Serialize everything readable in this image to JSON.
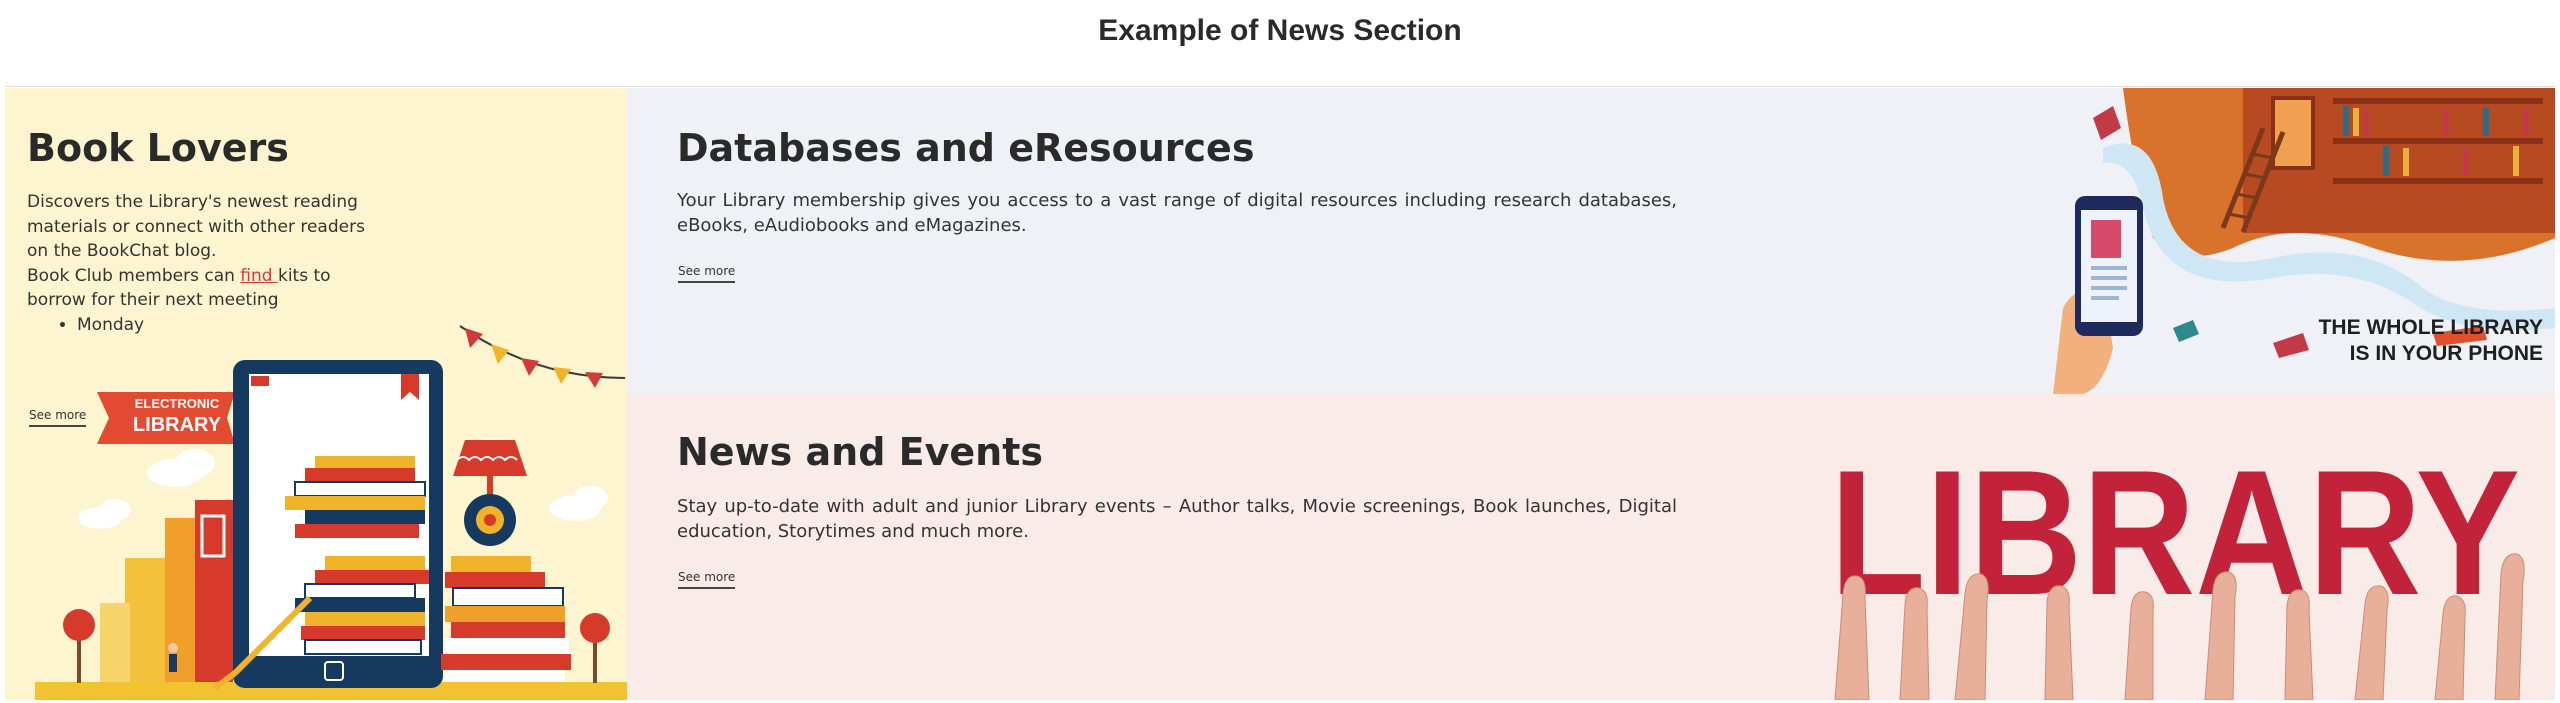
{
  "page": {
    "title": "Example of News Section"
  },
  "book_lovers": {
    "title": "Book Lovers",
    "line1": "Discovers the Library's newest reading materials or connect with other readers on the BookChat blog.",
    "line2_before": "Book Club members can ",
    "line2_link": "find ",
    "line2_after": "kits to borrow for their next meeting",
    "list": [
      "Monday"
    ],
    "see_more": "See more",
    "badge_top": "ELECTRONIC",
    "badge_bottom": "LIBRARY"
  },
  "databases": {
    "title": "Databases and eResources",
    "text": "Your Library membership gives you access to a vast range of digital resources including research databases, eBooks, eAudiobooks and eMagazines.",
    "see_more": "See more",
    "image_caption_1": "THE WHOLE LIBRARY",
    "image_caption_2": "IS IN YOUR PHONE"
  },
  "news": {
    "title": "News and Events",
    "text": "Stay up-to-date with adult and junior Library events – Author talks, Movie screenings, Book launches, Digital education, Storytimes and much more.",
    "see_more": "See more",
    "image_word": "LIBRARY"
  },
  "colors": {
    "left_bg": "#fdf5cf",
    "db_bg": "#eff1f6",
    "news_bg": "#f8ebe8",
    "accent_red": "#d23a3a"
  }
}
